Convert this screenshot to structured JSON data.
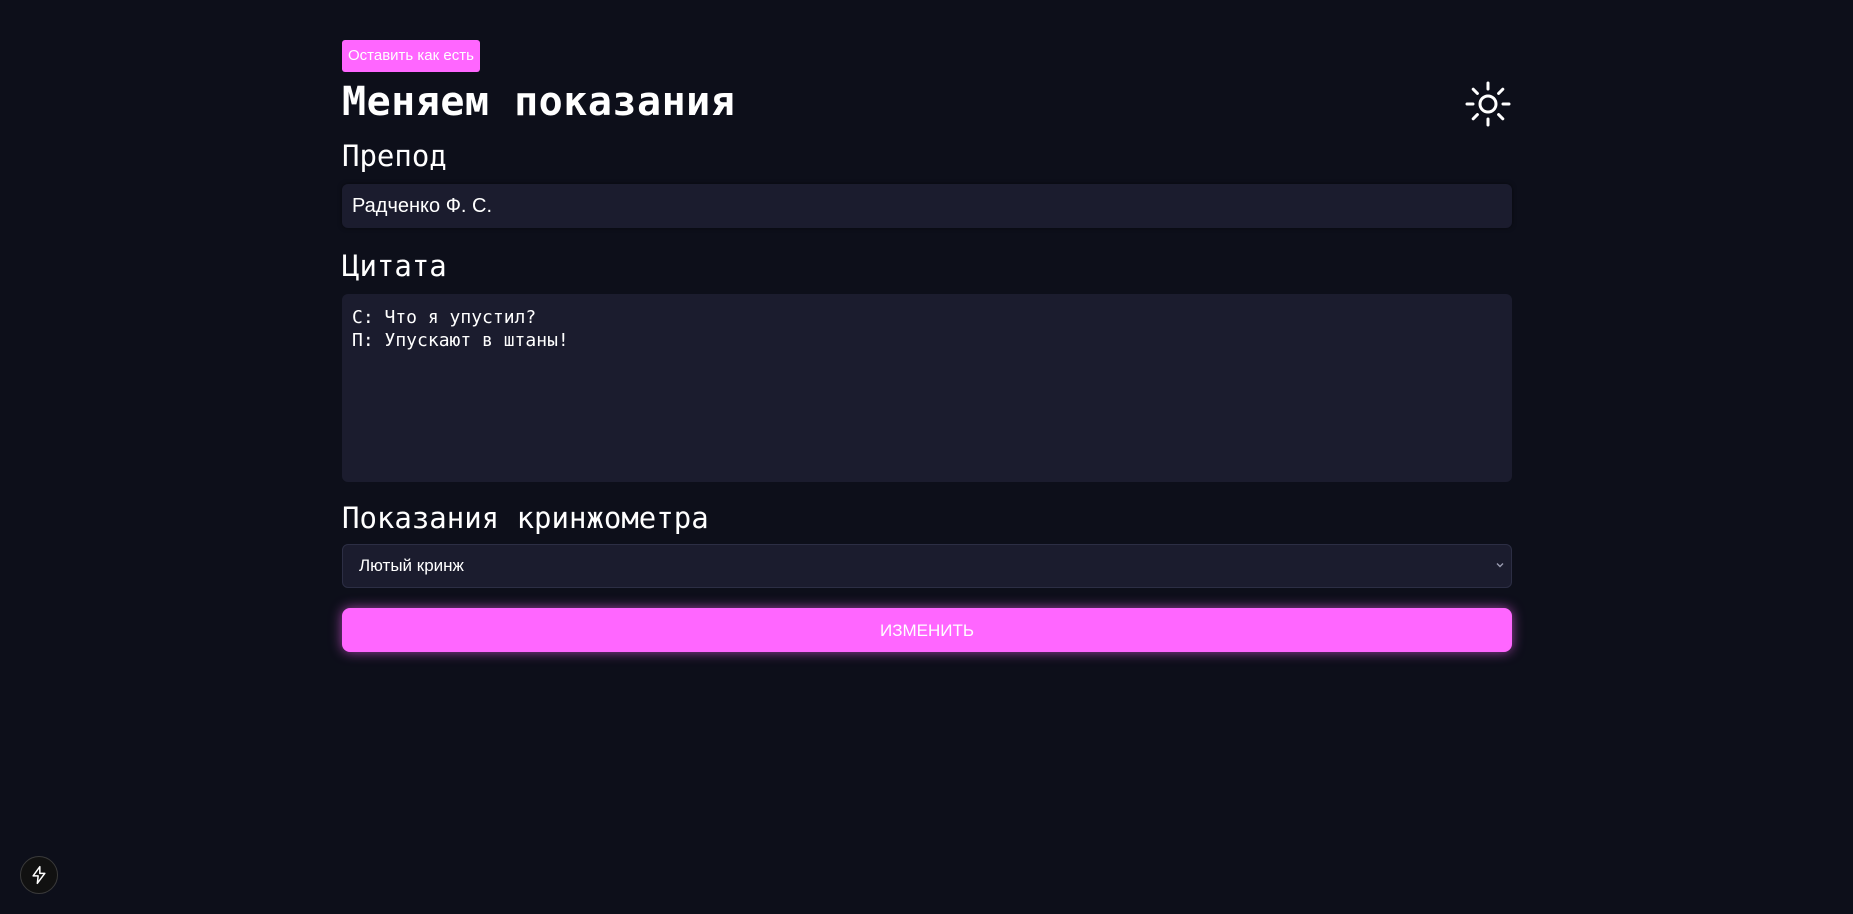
{
  "header": {
    "back_button_label": "Оставить как есть",
    "title": "Меняем показания",
    "theme_icon": "sun-icon"
  },
  "form": {
    "teacher": {
      "label": "Препод",
      "value": "Радченко Ф. С."
    },
    "quote": {
      "label": "Цитата",
      "value": "С: Что я упустил?\nП: Упускают в штаны!"
    },
    "meter": {
      "label": "Показания кринжометра",
      "selected": "Лютый кринж",
      "chevron_icon": "chevron-down-icon"
    },
    "submit_label": "ИЗМЕНИТЬ"
  },
  "dev_badge": {
    "icon": "lightning-icon"
  },
  "colors": {
    "background": "#0d0f1a",
    "field_background": "#1b1c2e",
    "accent": "#ff66ff",
    "text": "#ffffff"
  }
}
